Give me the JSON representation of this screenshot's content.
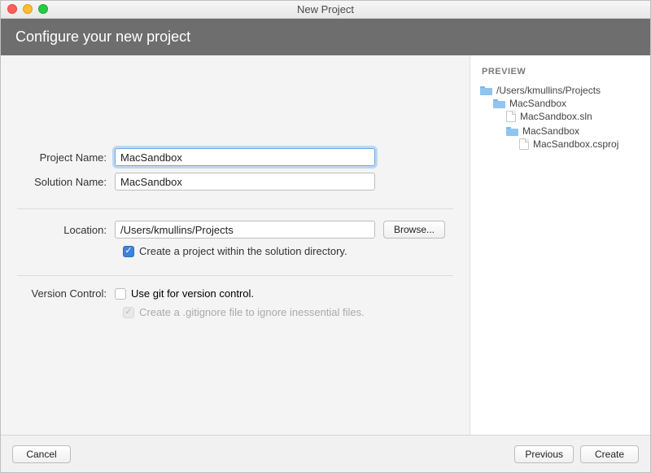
{
  "window": {
    "title": "New Project"
  },
  "header": {
    "title": "Configure your new project"
  },
  "form": {
    "project_name_label": "Project Name:",
    "project_name_value": "MacSandbox",
    "solution_name_label": "Solution Name:",
    "solution_name_value": "MacSandbox",
    "location_label": "Location:",
    "location_value": "/Users/kmullins/Projects",
    "browse_label": "Browse...",
    "create_within_label": "Create a project within the solution directory.",
    "create_within_checked": true,
    "version_control_label": "Version Control:",
    "use_git_label": "Use git for version control.",
    "use_git_checked": false,
    "gitignore_label": "Create a .gitignore file to ignore inessential files.",
    "gitignore_checked": true
  },
  "preview": {
    "title": "PREVIEW",
    "tree": {
      "root": "/Users/kmullins/Projects",
      "solution_folder": "MacSandbox",
      "solution_file": "MacSandbox.sln",
      "project_folder": "MacSandbox",
      "project_file": "MacSandbox.csproj"
    }
  },
  "footer": {
    "cancel": "Cancel",
    "previous": "Previous",
    "create": "Create"
  }
}
